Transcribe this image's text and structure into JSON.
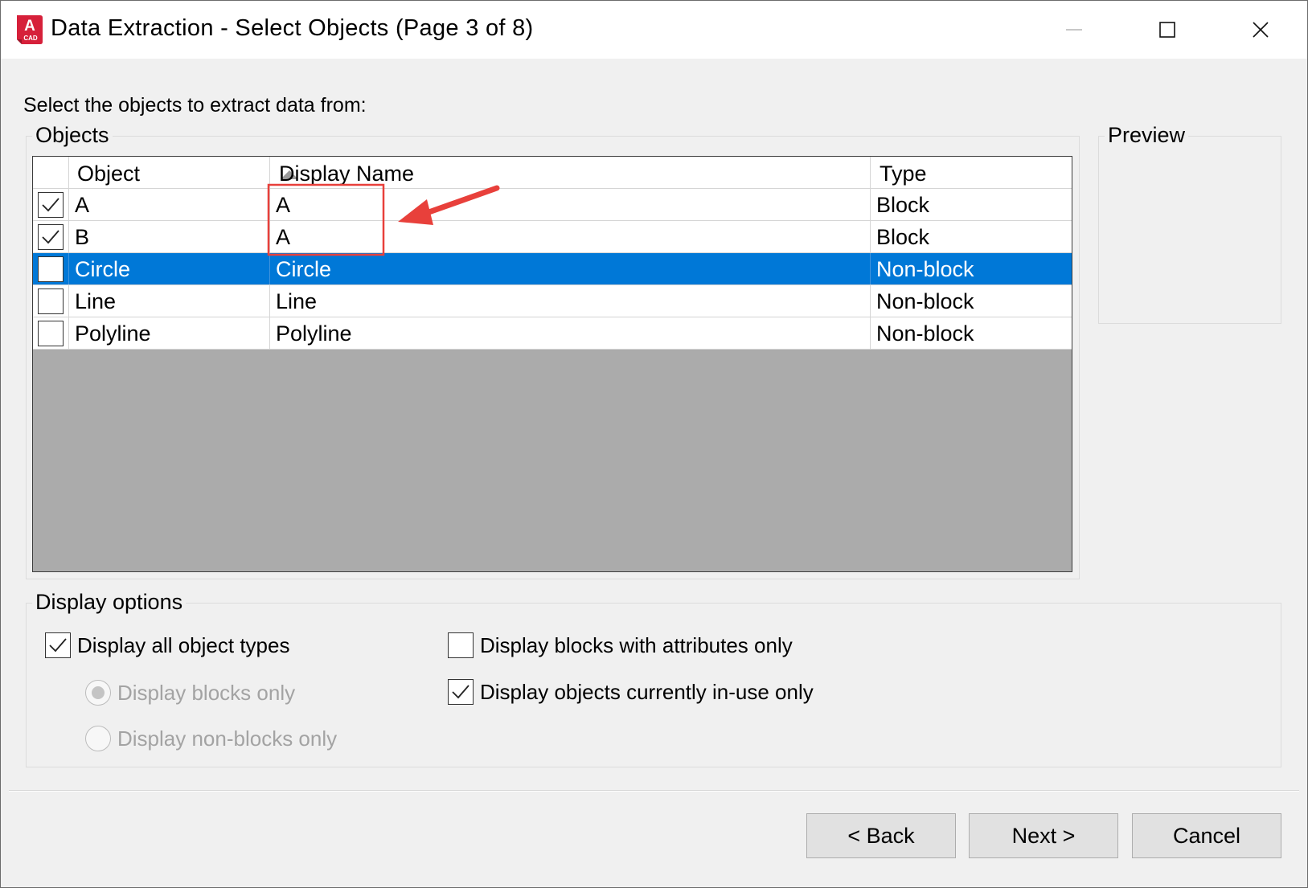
{
  "window": {
    "title": "Data Extraction - Select Objects (Page 3 of 8)",
    "app_icon_letter": "A",
    "app_icon_caption": "CAD",
    "app_icon_color": "#d6203a"
  },
  "prompt": "Select the objects to extract data from:",
  "objects_group": {
    "label": "Objects",
    "columns": [
      "Object",
      "Display Name",
      "Type"
    ],
    "sort_column": "Object",
    "sort_direction": "ascending",
    "rows": [
      {
        "checked": true,
        "object": "A",
        "display_name": "A",
        "type": "Block",
        "selected": false
      },
      {
        "checked": true,
        "object": "B",
        "display_name": "A",
        "type": "Block",
        "selected": false
      },
      {
        "checked": false,
        "object": "Circle",
        "display_name": "Circle",
        "type": "Non-block",
        "selected": true
      },
      {
        "checked": false,
        "object": "Line",
        "display_name": "Line",
        "type": "Non-block",
        "selected": false
      },
      {
        "checked": false,
        "object": "Polyline",
        "display_name": "Polyline",
        "type": "Non-block",
        "selected": false
      }
    ]
  },
  "preview_group": {
    "label": "Preview"
  },
  "display_options": {
    "label": "Display options",
    "display_all_types": {
      "label": "Display all object types",
      "checked": true
    },
    "blocks_only": {
      "label": "Display blocks only",
      "selected": true,
      "enabled": false
    },
    "non_blocks_only": {
      "label": "Display non-blocks only",
      "selected": false,
      "enabled": false
    },
    "blocks_with_attributes": {
      "label": "Display blocks with attributes only",
      "checked": false
    },
    "in_use_only": {
      "label": "Display objects currently in-use only",
      "checked": true
    }
  },
  "buttons": {
    "back": "< Back",
    "next": "Next >",
    "cancel": "Cancel"
  },
  "colors": {
    "selection": "#0078d7",
    "annotation": "#e8403b",
    "list_empty_area": "#ababab"
  }
}
